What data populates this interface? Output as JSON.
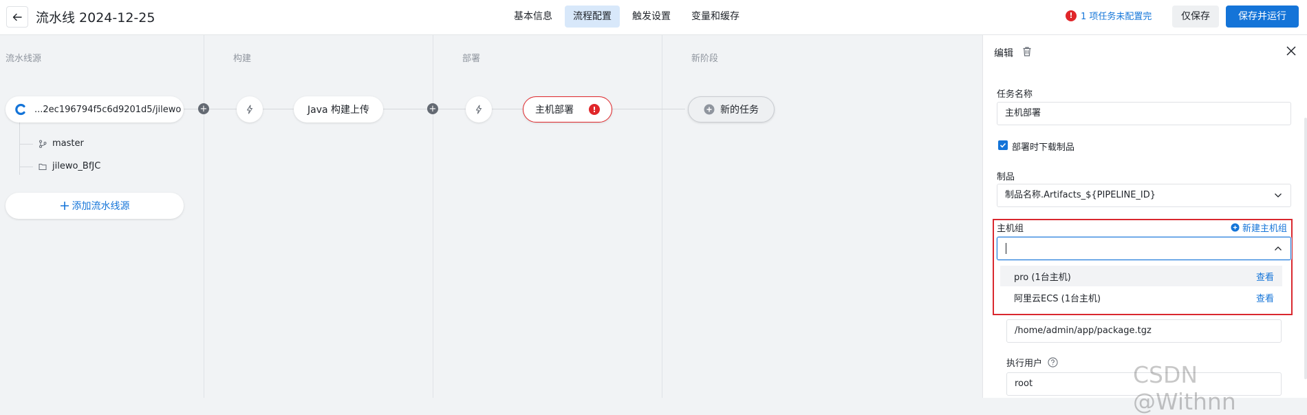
{
  "header": {
    "title": "流水线 2024-12-25",
    "tabs": [
      {
        "label": "基本信息",
        "active": false
      },
      {
        "label": "流程配置",
        "active": true
      },
      {
        "label": "触发设置",
        "active": false
      },
      {
        "label": "变量和缓存",
        "active": false
      }
    ],
    "warning_text": "1 项任务未配置完",
    "save_only_label": "仅保存",
    "save_run_label": "保存并运行"
  },
  "stages": {
    "source_label": "流水线源",
    "build_label": "构建",
    "deploy_label": "部署",
    "new_stage_label": "新阶段"
  },
  "source": {
    "repo_label": "...2ec196794f5c6d9201d5/jilewo",
    "branch": "master",
    "folder": "jilewo_BfJC",
    "add_source_label": "添加流水线源"
  },
  "build": {
    "task_label": "Java 构建上传"
  },
  "deploy": {
    "task_label": "主机部署"
  },
  "new_stage": {
    "task_label": "新的任务"
  },
  "panel": {
    "title": "编辑",
    "task_name_label": "任务名称",
    "task_name_value": "主机部署",
    "download_artifacts_label": "部署时下载制品",
    "download_artifacts_checked": true,
    "artifact_label": "制品",
    "artifact_value": "制品名称.Artifacts_${PIPELINE_ID}",
    "host_group_label": "主机组",
    "new_host_group_label": "新建主机组",
    "host_group_value": "",
    "host_group_options": [
      {
        "label": "pro (1台主机)",
        "view": "查看"
      },
      {
        "label": "阿里云ECS (1台主机)",
        "view": "查看"
      }
    ],
    "path_value": "/home/admin/app/package.tgz",
    "exec_user_label": "执行用户",
    "exec_user_value": "root"
  },
  "colors": {
    "primary": "#1474d8",
    "error": "#e0262a",
    "tab_active_bg": "#d8e8fa"
  },
  "watermark": "CSDN @Withnn"
}
